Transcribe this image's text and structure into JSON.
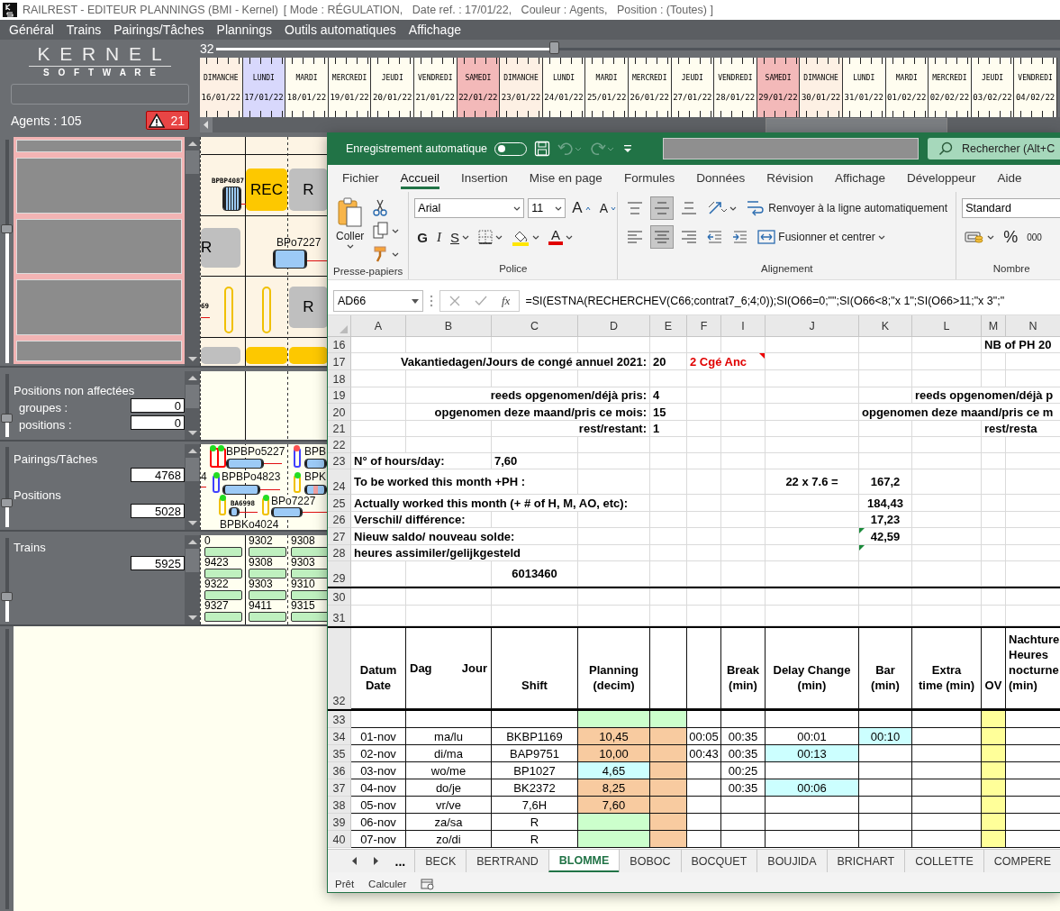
{
  "title_bar": {
    "title": "RAILREST - EDITEUR PLANNINGS (BMI - Kernel)",
    "context": "[ Mode : RÉGULATION,   Date ref. : 17/01/22,   Couleur : Agents,   Position : (Toutes) ]"
  },
  "menu": [
    "Général",
    "Trains",
    "Pairings/Tâches",
    "Plannings",
    "Outils automatiques",
    "Affichage"
  ],
  "brand": {
    "logo_top": "K E R N E L",
    "logo_bottom": "S O F T W A R E",
    "agents_label": "Agents : 105",
    "alert_count": "21"
  },
  "timeline": {
    "zoom_value": "32",
    "zoom": {
      "level": 0.4
    },
    "days": [
      {
        "day": "DIMANCHE",
        "date": "16/01/22",
        "kind": "sunday",
        "selected": false
      },
      {
        "day": "LUNDI",
        "date": "17/01/22",
        "kind": "weekday",
        "selected": true
      },
      {
        "day": "MARDI",
        "date": "18/01/22",
        "kind": "weekday",
        "selected": false
      },
      {
        "day": "MERCREDI",
        "date": "19/01/22",
        "kind": "weekday",
        "selected": false
      },
      {
        "day": "JEUDI",
        "date": "20/01/22",
        "kind": "weekday",
        "selected": false
      },
      {
        "day": "VENDREDI",
        "date": "21/01/22",
        "kind": "weekday",
        "selected": false
      },
      {
        "day": "SAMEDI",
        "date": "22/01/22",
        "kind": "saturday",
        "selected": false
      },
      {
        "day": "DIMANCHE",
        "date": "23/01/22",
        "kind": "sunday",
        "selected": false
      },
      {
        "day": "LUNDI",
        "date": "24/01/22",
        "kind": "weekday",
        "selected": false
      },
      {
        "day": "MARDI",
        "date": "25/01/22",
        "kind": "weekday",
        "selected": false
      },
      {
        "day": "MERCREDI",
        "date": "26/01/22",
        "kind": "weekday",
        "selected": false
      },
      {
        "day": "JEUDI",
        "date": "27/01/22",
        "kind": "weekday",
        "selected": false
      },
      {
        "day": "VENDREDI",
        "date": "28/01/22",
        "kind": "weekday",
        "selected": false
      },
      {
        "day": "SAMEDI",
        "date": "29/01/22",
        "kind": "saturday",
        "selected": false
      },
      {
        "day": "DIMANCHE",
        "date": "30/01/22",
        "kind": "sunday",
        "selected": false
      },
      {
        "day": "LUNDI",
        "date": "31/01/22",
        "kind": "weekday",
        "selected": false
      },
      {
        "day": "MARDI",
        "date": "01/02/22",
        "kind": "weekday",
        "selected": false
      },
      {
        "day": "MERCREDI",
        "date": "02/02/22",
        "kind": "weekday",
        "selected": false
      },
      {
        "day": "JEUDI",
        "date": "03/02/22",
        "kind": "weekday",
        "selected": false
      },
      {
        "day": "VENDREDI",
        "date": "04/02/22",
        "kind": "weekday",
        "selected": false
      }
    ]
  },
  "planning": {
    "slider": {
      "level": 0.6
    },
    "agent_rows": [
      {
        "highlighted": true
      },
      {
        "highlighted": true
      },
      {
        "highlighted": true
      },
      {
        "highlighted": true
      },
      {
        "highlighted": true
      }
    ],
    "items": [
      {
        "kind": "tag",
        "text": "BPBP4087"
      },
      {
        "kind": "task-striped"
      },
      {
        "kind": "link"
      },
      {
        "kind": "rec",
        "text": "REC"
      },
      {
        "kind": "rest",
        "text": "R"
      },
      {
        "kind": "rest",
        "text": "R"
      },
      {
        "kind": "code",
        "text": "BPo7227"
      },
      {
        "kind": "task"
      },
      {
        "kind": "link"
      },
      {
        "kind": "tag",
        "text": "69"
      },
      {
        "kind": "link"
      },
      {
        "kind": "slot"
      },
      {
        "kind": "slot"
      },
      {
        "kind": "rest",
        "text": "R"
      },
      {
        "kind": "rest"
      },
      {
        "kind": "rec"
      },
      {
        "kind": "rec"
      }
    ]
  },
  "unassigned": {
    "title": "Positions non affectées",
    "slider": {
      "level": 0.3
    },
    "fields": [
      {
        "label": "groupes :",
        "value": "0"
      },
      {
        "label": "positions :",
        "value": "0"
      }
    ]
  },
  "pairings": {
    "slider": {
      "level": 0.3
    },
    "fields": [
      {
        "label": "Pairings/Tâches",
        "value": "4768"
      },
      {
        "label": "Positions",
        "value": "5028"
      }
    ],
    "items": [
      {
        "kind": "marker-double",
        "color": "#ff0000"
      },
      {
        "kind": "dot",
        "color": "#22dd22"
      },
      {
        "kind": "dot",
        "color": "#22dd22"
      },
      {
        "kind": "code",
        "text": "BPBPo5227"
      },
      {
        "kind": "task"
      },
      {
        "kind": "link"
      },
      {
        "kind": "marker",
        "color": "#4040ff"
      },
      {
        "kind": "dot",
        "color": "#ff5050"
      },
      {
        "kind": "code",
        "text": "BPB"
      },
      {
        "kind": "task"
      },
      {
        "kind": "code",
        "text": "4"
      },
      {
        "kind": "link"
      },
      {
        "kind": "marker",
        "color": "#4040ff"
      },
      {
        "kind": "dot",
        "color": "#22dd22"
      },
      {
        "kind": "code",
        "text": "BPBPo4823"
      },
      {
        "kind": "task"
      },
      {
        "kind": "link"
      },
      {
        "kind": "marker",
        "color": "#f0c000"
      },
      {
        "kind": "dot",
        "color": "#22dd22"
      },
      {
        "kind": "code",
        "text": "BPK"
      },
      {
        "kind": "task"
      },
      {
        "kind": "marker",
        "color": "#f0c000"
      },
      {
        "kind": "dot",
        "color": "#22dd22"
      },
      {
        "kind": "tag",
        "text": "BA6998"
      },
      {
        "kind": "task"
      },
      {
        "kind": "link"
      },
      {
        "kind": "marker",
        "color": "#f0c000"
      },
      {
        "kind": "dot",
        "color": "#22dd22"
      },
      {
        "kind": "code",
        "text": "BPo7227"
      },
      {
        "kind": "task"
      },
      {
        "kind": "link"
      },
      {
        "kind": "code",
        "text": "BPBKo4024"
      }
    ]
  },
  "trains": {
    "label": "Trains",
    "value": "5925",
    "slider": {
      "level": 0.3
    },
    "numbers": [
      "0",
      "9302",
      "9308",
      "9423",
      "9308",
      "9303",
      "9322",
      "9303",
      "9310",
      "9327",
      "9411",
      "9315"
    ]
  },
  "excel": {
    "title_bar": {
      "autosave_label": "Enregistrement automatique",
      "autosave_on": false,
      "search_placeholder": "Rechercher (Alt+C"
    },
    "ribbon_tabs": [
      {
        "label": "Fichier",
        "selected": false
      },
      {
        "label": "Accueil",
        "selected": true
      },
      {
        "label": "Insertion",
        "selected": false
      },
      {
        "label": "Mise en page",
        "selected": false
      },
      {
        "label": "Formules",
        "selected": false
      },
      {
        "label": "Données",
        "selected": false
      },
      {
        "label": "Révision",
        "selected": false
      },
      {
        "label": "Affichage",
        "selected": false
      },
      {
        "label": "Développeur",
        "selected": false
      },
      {
        "label": "Aide",
        "selected": false
      }
    ],
    "ribbon_groups": [
      {
        "label": "Presse-papiers",
        "controls": [
          {
            "kind": "paste",
            "label": "Coller"
          },
          {
            "kind": "cut"
          },
          {
            "kind": "copy"
          },
          {
            "kind": "painter"
          }
        ]
      },
      {
        "label": "Police",
        "controls": [
          {
            "kind": "font-field",
            "value": "Arial"
          },
          {
            "kind": "size-field",
            "value": "11"
          },
          {
            "kind": "grow",
            "label": "A"
          },
          {
            "kind": "shrink",
            "label": "A"
          },
          {
            "kind": "bold",
            "label": "G"
          },
          {
            "kind": "italic",
            "label": "I"
          },
          {
            "kind": "underline",
            "label": "S"
          },
          {
            "kind": "borders"
          },
          {
            "kind": "fill"
          },
          {
            "kind": "font-color",
            "label": "A"
          }
        ]
      },
      {
        "label": "Alignement",
        "controls": [
          {
            "kind": "align-top",
            "selected": false
          },
          {
            "kind": "align-middle",
            "selected": true
          },
          {
            "kind": "align-bottom",
            "selected": false
          },
          {
            "kind": "orientation"
          },
          {
            "kind": "wrap",
            "label": "Renvoyer à la ligne automatiquement"
          },
          {
            "kind": "align-left",
            "selected": false
          },
          {
            "kind": "align-center",
            "selected": true
          },
          {
            "kind": "align-right",
            "selected": false
          },
          {
            "kind": "outdent"
          },
          {
            "kind": "indent"
          },
          {
            "kind": "merge",
            "label": "Fusionner et centrer"
          }
        ]
      },
      {
        "label": "Nombre",
        "controls": [
          {
            "kind": "format-field",
            "value": "Standard"
          },
          {
            "kind": "accounting"
          },
          {
            "kind": "percent",
            "label": "%"
          },
          {
            "kind": "thousands",
            "label": "000"
          }
        ]
      }
    ],
    "formula_bar": {
      "cell": "AD66",
      "fx": "fx",
      "formula": "=SI(ESTNA(RECHERCHEV(C66;contrat7_6;4;0));SI(O66=0;\"\";SI(O66<8;\"x 1\";SI(O66>11;\"x 3\";\""
    },
    "sheet": {
      "columns": [
        "A",
        "B",
        "C",
        "D",
        "E",
        "F",
        "I",
        "J",
        "K",
        "L",
        "M",
        "N"
      ],
      "rows": [
        {
          "number": "16",
          "kind": "info",
          "cells": [
            {},
            {},
            {},
            {},
            {},
            {},
            {},
            {},
            {},
            {},
            {
              "text": "NB of PH 20",
              "kind": "left"
            },
            {}
          ]
        },
        {
          "number": "17",
          "kind": "info",
          "cells": [
            {},
            {},
            {},
            {
              "text": "Vakantiedagen/Jours de congé annuel 2021:",
              "kind": "right"
            },
            {
              "text": "20",
              "kind": "left"
            },
            {
              "text": "2 Cgé Anc",
              "kind": "alert",
              "note": true
            },
            {},
            {},
            {},
            {},
            {},
            {}
          ]
        },
        {
          "number": "18",
          "kind": "blank"
        },
        {
          "number": "19",
          "kind": "info",
          "cells": [
            {},
            {},
            {},
            {
              "text": "reeds opgenomen/déjà pris:",
              "kind": "right"
            },
            {
              "text": "4",
              "kind": "left"
            },
            {},
            {},
            {},
            {},
            {
              "text": "reeds opgenomen/déjà p",
              "kind": "left"
            },
            {},
            {}
          ]
        },
        {
          "number": "20",
          "kind": "info",
          "cells": [
            {},
            {},
            {},
            {
              "text": "opgenomen deze maand/pris ce mois:",
              "kind": "right"
            },
            {
              "text": "15",
              "kind": "left"
            },
            {},
            {},
            {},
            {
              "text": "opgenomen deze maand/pris ce m",
              "kind": "left"
            },
            {},
            {},
            {}
          ]
        },
        {
          "number": "21",
          "kind": "info",
          "cells": [
            {},
            {},
            {},
            {
              "text": "rest/restant:",
              "kind": "right"
            },
            {
              "text": "1",
              "kind": "left"
            },
            {},
            {},
            {},
            {},
            {},
            {
              "text": "rest/resta",
              "kind": "left"
            },
            {}
          ]
        },
        {
          "number": "22",
          "kind": "blank"
        },
        {
          "number": "23",
          "kind": "info",
          "cells": [
            {
              "text": "N° of hours/day:",
              "kind": "left"
            },
            {},
            {
              "text": "7,60",
              "kind": "left"
            },
            {},
            {},
            {},
            {},
            {},
            {},
            {},
            {},
            {}
          ]
        },
        {
          "number": "24",
          "kind": "info",
          "cells": [
            {
              "text": "To be worked this month +PH :",
              "kind": "left"
            },
            {},
            {},
            {},
            {},
            {},
            {},
            {
              "text": "22  x 7.6 =",
              "kind": "center"
            },
            {
              "text": "167,2",
              "kind": "center"
            },
            {},
            {},
            {}
          ]
        },
        {
          "number": "25",
          "kind": "info",
          "cells": [
            {
              "text": "Actually worked this month (+ # of H, M, AO, etc):",
              "kind": "left"
            },
            {},
            {},
            {},
            {},
            {},
            {},
            {},
            {
              "text": "184,43",
              "kind": "center"
            },
            {},
            {},
            {}
          ]
        },
        {
          "number": "26",
          "kind": "info",
          "cells": [
            {
              "text": "Verschil/ différence:",
              "kind": "left"
            },
            {},
            {},
            {},
            {},
            {},
            {},
            {},
            {
              "text": "17,23",
              "kind": "center"
            },
            {},
            {},
            {}
          ]
        },
        {
          "number": "27",
          "kind": "info",
          "cells": [
            {
              "text": "Nieuw saldo/ nouveau solde:",
              "kind": "left"
            },
            {},
            {},
            {},
            {},
            {},
            {},
            {},
            {
              "text": "42,59",
              "kind": "center",
              "flag": true
            },
            {},
            {},
            {}
          ]
        },
        {
          "number": "28",
          "kind": "info",
          "cells": [
            {
              "text": "heures assimiler/gelijkgesteld",
              "kind": "left"
            },
            {},
            {},
            {},
            {},
            {},
            {},
            {},
            {
              "flag": true
            },
            {},
            {},
            {}
          ]
        },
        {
          "number": "29",
          "kind": "info",
          "rule_below": true,
          "cells": [
            {},
            {},
            {
              "text": "6013460",
              "kind": "center"
            },
            {},
            {},
            {},
            {},
            {},
            {},
            {},
            {},
            {}
          ]
        },
        {
          "number": "30",
          "kind": "blank"
        },
        {
          "number": "31",
          "kind": "blank",
          "rule_below": true
        },
        {
          "number": "32",
          "kind": "heading",
          "rule_below": true,
          "cells": [
            {
              "text": "Datum\nDate",
              "kind": "center"
            },
            {
              "parts": [
                "Dag",
                "Jour"
              ],
              "kind": "split"
            },
            {
              "text": "Shift",
              "kind": "center"
            },
            {
              "text": "Planning\n(decim)",
              "kind": "center"
            },
            {},
            {},
            {
              "text": "Break\n(min)",
              "kind": "center"
            },
            {
              "text": "Delay Change\n(min)",
              "kind": "center"
            },
            {
              "text": "Bar\n(min)",
              "kind": "center"
            },
            {
              "text": "Extra\ntime   (min)",
              "kind": "center"
            },
            {
              "text": "OV",
              "kind": "center"
            },
            {
              "text": "Nachture\nHeures\nnocturne\n(min)",
              "kind": "left"
            }
          ]
        },
        {
          "number": "33",
          "kind": "data",
          "cells": [
            {},
            {},
            {},
            {
              "color": "#ccffcc"
            },
            {
              "color": "#ccffcc"
            },
            {},
            {},
            {},
            {},
            {},
            {
              "color": "#ffff99"
            },
            {}
          ]
        },
        {
          "number": "34",
          "kind": "data",
          "cells": [
            {
              "text": "01-nov"
            },
            {
              "text": "ma/lu"
            },
            {
              "text": "BKBP1169"
            },
            {
              "text": "10,45",
              "color": "#f8cba0"
            },
            {
              "color": "#f8cba0"
            },
            {
              "text": "00:05"
            },
            {
              "text": "00:35"
            },
            {
              "text": "00:01"
            },
            {
              "text": "00:10",
              "color": "#ccffff"
            },
            {},
            {
              "color": "#ffff99"
            },
            {}
          ]
        },
        {
          "number": "35",
          "kind": "data",
          "cells": [
            {
              "text": "02-nov"
            },
            {
              "text": "di/ma"
            },
            {
              "text": "BAP9751"
            },
            {
              "text": "10,00",
              "color": "#f8cba0"
            },
            {
              "color": "#f8cba0"
            },
            {
              "text": "00:43"
            },
            {
              "text": "00:35"
            },
            {
              "text": "00:13",
              "color": "#ccffff"
            },
            {},
            {},
            {
              "color": "#ffff99"
            },
            {}
          ]
        },
        {
          "number": "36",
          "kind": "data",
          "cells": [
            {
              "text": "03-nov"
            },
            {
              "text": "wo/me"
            },
            {
              "text": "BP1027"
            },
            {
              "text": "4,65",
              "color": "#ccffff"
            },
            {
              "color": "#f8cba0"
            },
            {},
            {
              "text": "00:25"
            },
            {},
            {},
            {},
            {
              "color": "#ffff99"
            },
            {}
          ]
        },
        {
          "number": "37",
          "kind": "data",
          "cells": [
            {
              "text": "04-nov"
            },
            {
              "text": "do/je"
            },
            {
              "text": "BK2372"
            },
            {
              "text": "8,25",
              "color": "#f8cba0"
            },
            {
              "color": "#f8cba0"
            },
            {},
            {
              "text": "00:35"
            },
            {
              "text": "00:06",
              "color": "#ccffff"
            },
            {},
            {},
            {
              "color": "#ffff99"
            },
            {}
          ]
        },
        {
          "number": "38",
          "kind": "data",
          "cells": [
            {
              "text": "05-nov"
            },
            {
              "text": "vr/ve"
            },
            {
              "text": "7,6H"
            },
            {
              "text": "7,60",
              "color": "#f8cba0"
            },
            {
              "color": "#f8cba0"
            },
            {},
            {},
            {},
            {},
            {},
            {
              "color": "#ffff99"
            },
            {}
          ]
        },
        {
          "number": "39",
          "kind": "data",
          "cells": [
            {
              "text": "06-nov"
            },
            {
              "text": "za/sa"
            },
            {
              "text": "R"
            },
            {
              "color": "#ccffcc"
            },
            {
              "color": "#f8cba0"
            },
            {},
            {},
            {},
            {},
            {},
            {
              "color": "#ffff99"
            },
            {}
          ]
        },
        {
          "number": "40",
          "kind": "data",
          "cells": [
            {
              "text": "07-nov"
            },
            {
              "text": "zo/di"
            },
            {
              "text": "R"
            },
            {
              "color": "#ccffcc"
            },
            {
              "color": "#f8cba0"
            },
            {},
            {},
            {},
            {},
            {},
            {
              "color": "#ffff99"
            },
            {}
          ]
        }
      ]
    },
    "sheet_tabs": {
      "more": "...",
      "tabs": [
        {
          "label": "BECK",
          "selected": false
        },
        {
          "label": "BERTRAND",
          "selected": false
        },
        {
          "label": "BLOMME",
          "selected": true
        },
        {
          "label": "BOBOC",
          "selected": false
        },
        {
          "label": "BOCQUET",
          "selected": false
        },
        {
          "label": "BOUJIDA",
          "selected": false
        },
        {
          "label": "BRICHART",
          "selected": false
        },
        {
          "label": "COLLETTE",
          "selected": false
        },
        {
          "label": "COMPERE",
          "selected": false
        }
      ]
    },
    "status_bar": {
      "state": "Prêt",
      "calc": "Calculer"
    }
  }
}
